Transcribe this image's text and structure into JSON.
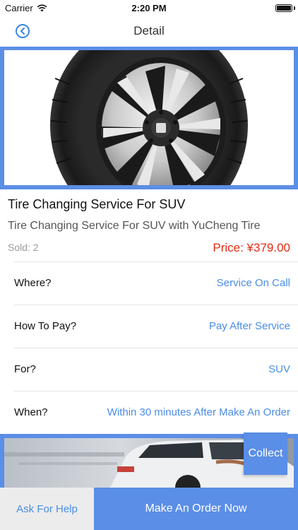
{
  "status_bar": {
    "carrier": "Carrier",
    "time": "2:20 PM",
    "wifi_icon": "wifi-icon",
    "battery_icon": "battery-icon"
  },
  "nav": {
    "title": "Detail",
    "back_icon": "chevron-left-circle-icon"
  },
  "product": {
    "image_icon": "tire-image",
    "title": "Tire Changing Service For SUV",
    "subtitle": "Tire Changing Service For SUV with YuCheng Tire",
    "sold": "Sold: 2",
    "price": "Price: ¥379.00"
  },
  "details": [
    {
      "label": "Where?",
      "value": "Service On Call"
    },
    {
      "label": "How To Pay?",
      "value": "Pay After Service"
    },
    {
      "label": "For?",
      "value": "SUV"
    },
    {
      "label": "When?",
      "value": "Within 30 minutes After Make An Order"
    }
  ],
  "banner": {
    "image_icon": "car-banner-image"
  },
  "actions": {
    "collect": "Collect",
    "help": "Ask For Help",
    "order": "Make An Order Now"
  },
  "colors": {
    "accent": "#5b8ee6",
    "link": "#4a8de6",
    "price": "#e02a14"
  }
}
